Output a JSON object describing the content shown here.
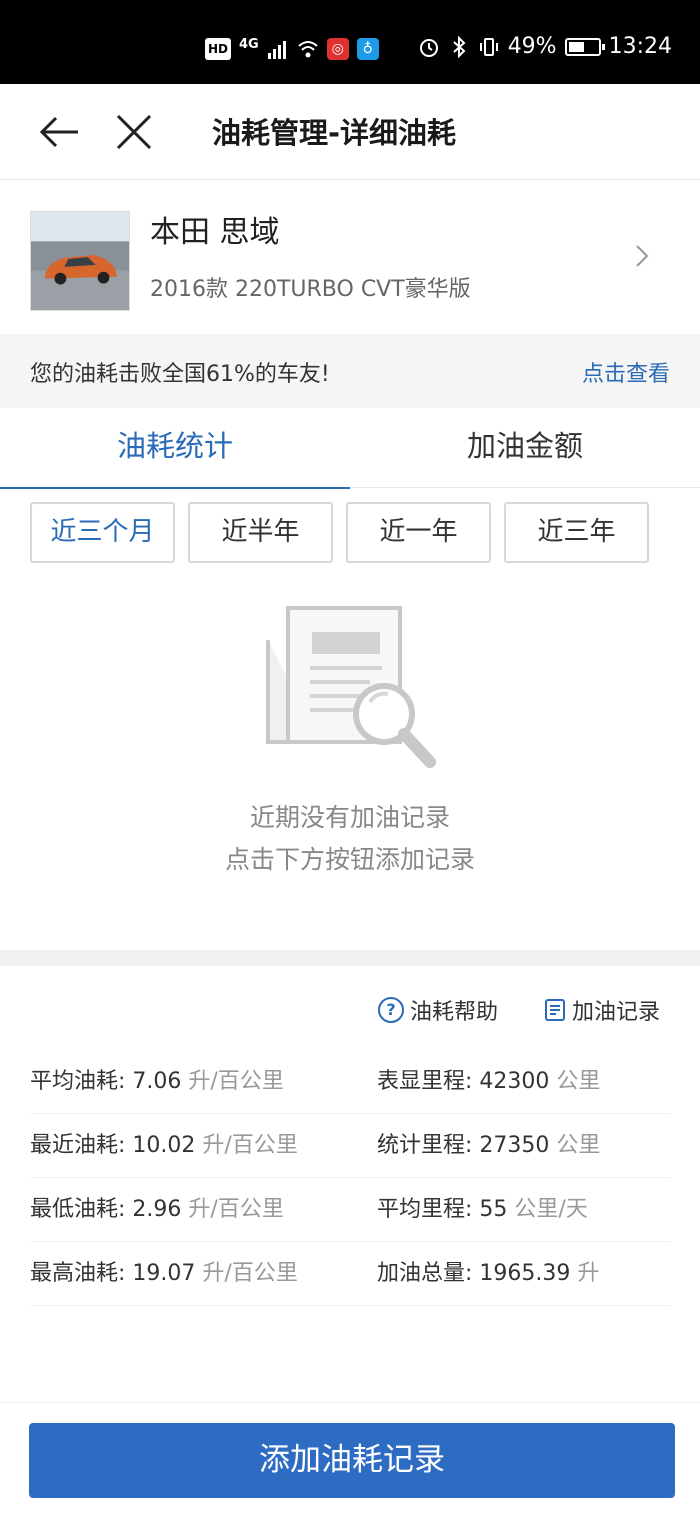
{
  "status_bar": {
    "hd_label": "HD",
    "network_label": "4G",
    "battery_percent": "49%",
    "battery_level": 0.49,
    "time": "13:24"
  },
  "nav": {
    "title": "油耗管理-详细油耗",
    "back_icon": "arrow-left-icon",
    "close_icon": "close-icon"
  },
  "car": {
    "name": "本田 思域",
    "model": "2016款 220TURBO CVT豪华版"
  },
  "rank": {
    "text": "您的油耗击败全国61%的车友!",
    "link": "点击查看"
  },
  "tabs": [
    {
      "label": "油耗统计",
      "active": true
    },
    {
      "label": "加油金额",
      "active": false
    }
  ],
  "periods": [
    {
      "label": "近三个月",
      "active": true
    },
    {
      "label": "近半年",
      "active": false
    },
    {
      "label": "近一年",
      "active": false
    },
    {
      "label": "近三年",
      "active": false
    }
  ],
  "empty_state": {
    "line1": "近期没有加油记录",
    "line2": "点击下方按钮添加记录"
  },
  "links": {
    "help": "油耗帮助",
    "records": "加油记录"
  },
  "stats": [
    {
      "left_label": "平均油耗:",
      "left_value": "7.06",
      "left_unit": "升/百公里",
      "right_label": "表显里程:",
      "right_value": "42300",
      "right_unit": "公里"
    },
    {
      "left_label": "最近油耗:",
      "left_value": "10.02",
      "left_unit": "升/百公里",
      "right_label": "统计里程:",
      "right_value": "27350",
      "right_unit": "公里"
    },
    {
      "left_label": "最低油耗:",
      "left_value": "2.96",
      "left_unit": "升/百公里",
      "right_label": "平均里程:",
      "right_value": "55",
      "right_unit": "公里/天"
    },
    {
      "left_label": "最高油耗:",
      "left_value": "19.07",
      "left_unit": "升/百公里",
      "right_label": "加油总量:",
      "right_value": "1965.39",
      "right_unit": "升"
    }
  ],
  "bottom_button": "添加油耗记录",
  "colors": {
    "accent": "#2a6bb8",
    "button": "#2d6cc2"
  }
}
